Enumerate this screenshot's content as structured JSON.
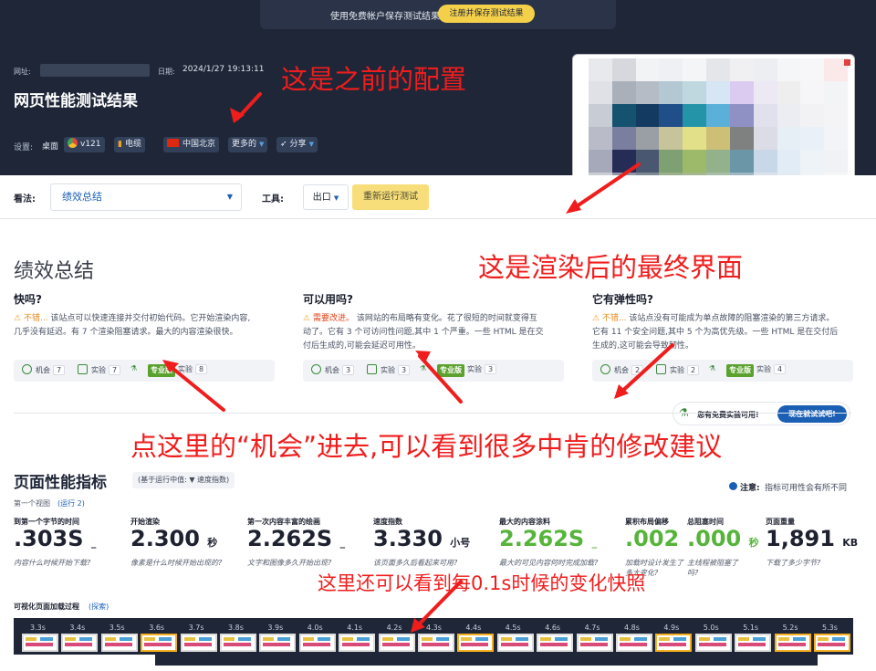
{
  "banner": {
    "text": "使用免费帐户保存测试结果",
    "button": "注册并保存测试结果"
  },
  "header": {
    "url_label": "网址:",
    "date_label": "日期:",
    "date": "2024/1/27 19:13:11",
    "title": "网页性能测试结果",
    "settings_label": "设置:",
    "device": "桌面",
    "browser": "v121",
    "connection": "电缆",
    "location": "中国北京",
    "more": "更多的",
    "share": "分享"
  },
  "toolbar": {
    "view_label": "看法:",
    "view_value": "绩效总结",
    "tools_label": "工具:",
    "export": "出口",
    "rerun": "重新运行测试"
  },
  "summary": {
    "title": "绩效总结",
    "cards": [
      {
        "title": "快吗?",
        "status": "不错...",
        "text1": "该站点可以快速连接并交付初始代码。它开始渲染内容,",
        "text2": "几乎没有延迟。有 7 个渲染阻塞请求。最大的内容渲染很快。",
        "text3": "",
        "opp": "7",
        "exp": "7",
        "tests": "8",
        "status_color": "#e78a1c"
      },
      {
        "title": "可以用吗?",
        "status": "需要改进。",
        "text1": "该网站的布局略有变化。花了很短的时间就变得互",
        "text2": "动了。它有 3 个可访问性问题,其中 1 个严重。一些 HTML 是在交",
        "text3": "付后生成的,可能会延迟可用性。",
        "opp": "3",
        "exp": "3",
        "tests": "3",
        "status_color": "#e0441a"
      },
      {
        "title": "它有弹性吗?",
        "status": "不错...",
        "text1": "该站点没有可能成为单点故障的阻塞渲染的第三方请求。",
        "text2": "它有 11 个安全问题,其中 5 个为高优先级。一些 HTML 是在交付后",
        "text3": "生成的,这可能会导致韧性。",
        "opp": "2",
        "exp": "2",
        "tests": "4",
        "status_color": "#e78a1c"
      }
    ],
    "chip_opp": "机会",
    "chip_exp": "实验",
    "chip_pro": "专业版",
    "promo_text": "您有免费实验可用!",
    "promo_btn": "现在就试试吧!"
  },
  "metrics": {
    "title": "页面性能指标",
    "median": "(基于运行中值: ▼ 速度指数)",
    "first_view": "第一个视图",
    "run": "(运行 2)",
    "note_label": "注意:",
    "note": "指标可用性会有所不同",
    "items": [
      {
        "label": "到第一个字节的时间",
        "value": ".303S",
        "unit": "_",
        "desc": "内容什么时候开始下载?",
        "color": "#1e2230"
      },
      {
        "label": "开始渲染",
        "value": "2.300",
        "unit": "秒",
        "desc": "像素是什么时候开始出现的?",
        "color": "#1e2230"
      },
      {
        "label": "第一次内容丰富的绘画",
        "value": "2.262S",
        "unit": "_",
        "desc": "文字和图像多久开始出现?",
        "color": "#1e2230"
      },
      {
        "label": "速度指数",
        "value": "3.330",
        "unit": "小号",
        "desc": "该页面多久后看起来可用?",
        "color": "#1e2230"
      },
      {
        "label": "最大的内容涂料",
        "value": "2.262S",
        "unit": "_",
        "desc": "最大的可见内容何时完成加载?",
        "color": "#56b43a"
      },
      {
        "label": "累积布局偏移",
        "value": ".002",
        "unit": "",
        "desc": "加载时设计发生了多大变化?",
        "color": "#56b43a"
      },
      {
        "label": "总阻塞时间",
        "value": ".000",
        "unit": "秒",
        "desc": "主线程被阻塞了吗?",
        "color": "#56b43a"
      },
      {
        "label": "页面重量",
        "value": "1,891",
        "unit": "KB",
        "desc": "下载了多少字节?",
        "color": "#1e2230"
      }
    ]
  },
  "filmstrip": {
    "label": "可视化页面加载过程",
    "link": "探索",
    "times": [
      "3.3s",
      "3.4s",
      "3.5s",
      "3.6s",
      "3.7s",
      "3.8s",
      "3.9s",
      "4.0s",
      "4.1s",
      "4.2s",
      "4.3s",
      "4.4s",
      "4.5s",
      "4.6s",
      "4.7s",
      "4.8s",
      "4.9s",
      "5.0s",
      "5.1s",
      "5.2s",
      "5.3s"
    ],
    "highlighted": [
      false,
      false,
      false,
      true,
      false,
      false,
      false,
      false,
      false,
      false,
      false,
      true,
      false,
      false,
      false,
      false,
      true,
      false,
      false,
      true,
      true
    ]
  },
  "annotations": {
    "a1": "这是之前的配置",
    "a2": "这是渲染后的最终界面",
    "a3": "点这里的“机会”进去,可以看到很多中肯的修改建议",
    "a4": "这里还可以看到每0.1s时候的变化快照"
  },
  "colors": {
    "header_bg": "#1e2637",
    "accent": "#f4d04a",
    "link": "#1a5fb4",
    "good": "#56b43a",
    "annotation": "#f01d1d"
  }
}
